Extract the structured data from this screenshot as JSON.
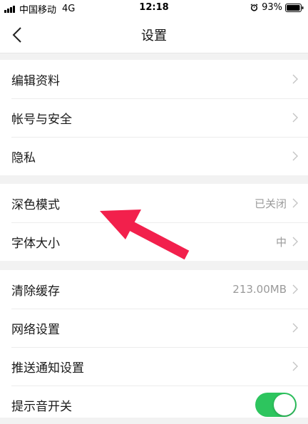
{
  "status_bar": {
    "carrier": "中国移动",
    "network": "4G",
    "time": "12:18",
    "battery": "93%"
  },
  "nav": {
    "title": "设置",
    "back_icon": "chevron-left-icon"
  },
  "groups": [
    {
      "items": [
        {
          "label": "编辑资料",
          "value": ""
        },
        {
          "label": "帐号与安全",
          "value": ""
        },
        {
          "label": "隐私",
          "value": ""
        }
      ]
    },
    {
      "items": [
        {
          "label": "深色模式",
          "value": "已关闭"
        },
        {
          "label": "字体大小",
          "value": "中"
        }
      ]
    },
    {
      "items": [
        {
          "label": "清除缓存",
          "value": "213.00MB"
        },
        {
          "label": "网络设置",
          "value": ""
        },
        {
          "label": "推送通知设置",
          "value": ""
        },
        {
          "label": "提示音开关",
          "value": "",
          "toggle_on": true
        }
      ]
    }
  ],
  "colors": {
    "toggle_on": "#2dc55e",
    "annotation_arrow": "#f2204c",
    "background": "#f2f2f2"
  }
}
